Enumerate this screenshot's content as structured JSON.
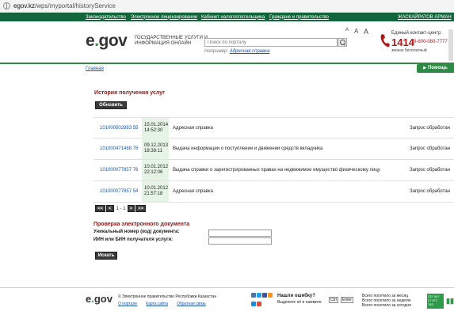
{
  "browser": {
    "url_domain": "egov.kz",
    "url_path": "/wps/myportal/historyService"
  },
  "topnav": {
    "items": [
      "Законодательство",
      "Электронное лицензирование",
      "Кабинет налогоплательщика",
      "Граждане и правительство"
    ],
    "user": "ЖАСКАЙРАТОВ АРМАН"
  },
  "header": {
    "logo_e": "e",
    "logo_gov": "gov",
    "logo_text": "ГОСУДАРСТВЕННЫЕ УСЛУГИ И ИНФОРМАЦИЯ ОНЛАЙН",
    "search_placeholder": "Поиск по порталу",
    "example_label": "Например:",
    "example_link": "Адресная справка",
    "font_sizes": [
      "A",
      "A",
      "A"
    ],
    "contact_label": "Единый контакт-центр",
    "contact_short": "1414",
    "contact_long": "8-800-080-7777",
    "contact_free": "звонок бесплатный"
  },
  "breadcrumb": "Главная",
  "help_label": "Помощь",
  "history": {
    "title": "История получения услуг",
    "refresh_label": "Обновить",
    "rows": [
      {
        "num": "101000502883 55",
        "date": "15.01.2014",
        "time": "14:52:30",
        "name": "Адресная справка",
        "status": "Запрос обработан"
      },
      {
        "num": "101000471488 76",
        "date": "09.12.2013",
        "time": "18:39:11",
        "name": "Выдача информации о поступлении и движении средств вкладчика",
        "status": "Запрос обработан"
      },
      {
        "num": "101000077857 76",
        "date": "10.01.2012",
        "time": "22:12:06",
        "name": "Выдача справки о зарегистрированных правах на недвижимое имущество физическому лицу",
        "status": "Запрос обработан"
      },
      {
        "num": "101000077857 54",
        "date": "10.01.2012",
        "time": "21:57:18",
        "name": "Адресная справка",
        "status": "Запрос обработан"
      }
    ],
    "pager": {
      "first": "<<",
      "prev": "<",
      "info": "1 - 1",
      "next": ">",
      "last": ">>"
    }
  },
  "verify": {
    "title": "Проверка электронного документа",
    "label_number": "Уникальный номер (код) документа:",
    "label_iin": "ИИН или БИН получателя услуги:",
    "search_label": "Искать"
  },
  "footer": {
    "logo_e": "e",
    "logo_gov": "gov",
    "copyright": "© Электронное правительство Республики Казахстан",
    "links": [
      "О портале",
      "Карта сайта",
      "Обратная связь"
    ],
    "error_title": "Нашли ошибку?",
    "error_text": "Выделите её и нажмите",
    "kb_ctrl": "Ctrl",
    "kb_enter": "Enter",
    "stats": "Всего посетило за месяц\nВсего посетило за неделю\nВсего посетило за сегодня",
    "counter": "237 097\n27 977\n763"
  }
}
